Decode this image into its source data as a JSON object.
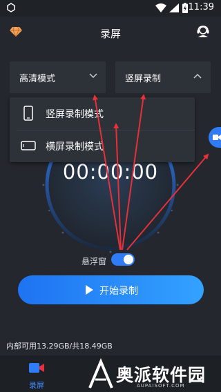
{
  "status_bar": {
    "time": "11:39"
  },
  "app_bar": {
    "title": "录屏"
  },
  "dropdowns": {
    "quality": {
      "label": "高清模式"
    },
    "orientation": {
      "label": "竖屏录制"
    }
  },
  "orientation_menu": {
    "items": [
      {
        "label": "竖屏录制模式",
        "icon": "phone-portrait-icon"
      },
      {
        "label": "横屏录制模式",
        "icon": "phone-landscape-icon"
      }
    ]
  },
  "timer": {
    "value": "00:00:00"
  },
  "floating_window": {
    "label": "悬浮窗",
    "enabled": true
  },
  "start_button": {
    "label": "开始录制"
  },
  "storage": {
    "text": "内部可用13.29GB/共18.49GB"
  },
  "bottom_nav": {
    "items": [
      {
        "label": "录屏",
        "active": true
      }
    ]
  },
  "watermark": {
    "text": "奥派软件园",
    "subtext": "AUPAISOFT.COM"
  },
  "colors": {
    "accent": "#2f7cf6",
    "arrow": "#e8303a",
    "background": "#24272d"
  }
}
